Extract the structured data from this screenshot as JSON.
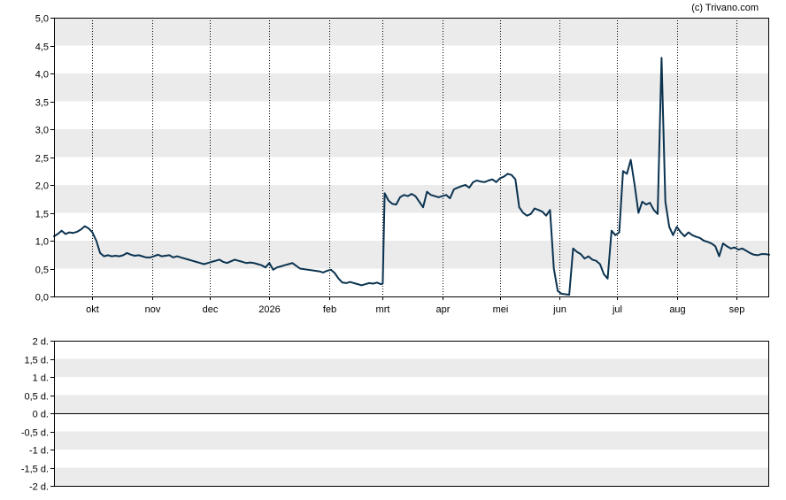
{
  "credit": "(c) Trivano.com",
  "colors": {
    "line": "#0b3350",
    "band": "#ebebeb",
    "border": "#000000",
    "month_grid": "#000000"
  },
  "chart_data": [
    {
      "type": "line",
      "title": "",
      "xlabel": "",
      "ylabel": "",
      "ylim": [
        0,
        5
      ],
      "grid": "alternating horizontal bands; dotted vertical lines at month starts",
      "y_ticks": [
        "0,0",
        "0,5",
        "1,0",
        "1,5",
        "2,0",
        "2,5",
        "3,0",
        "3,5",
        "4,0",
        "4,5",
        "5,0"
      ],
      "x_ticks": [
        {
          "label": "okt",
          "day": 20
        },
        {
          "label": "nov",
          "day": 51
        },
        {
          "label": "dec",
          "day": 81
        },
        {
          "label": "2026",
          "day": 112
        },
        {
          "label": "feb",
          "day": 143
        },
        {
          "label": "mrt",
          "day": 171
        },
        {
          "label": "apr",
          "day": 202
        },
        {
          "label": "mei",
          "day": 232
        },
        {
          "label": "jun",
          "day": 263
        },
        {
          "label": "jul",
          "day": 293
        },
        {
          "label": "aug",
          "day": 324
        },
        {
          "label": "sep",
          "day": 355
        }
      ],
      "x_domain": [
        0,
        372
      ],
      "series": [
        {
          "points": [
            [
              0,
              1.08
            ],
            [
              2,
              1.12
            ],
            [
              4,
              1.18
            ],
            [
              6,
              1.12
            ],
            [
              8,
              1.15
            ],
            [
              10,
              1.14
            ],
            [
              12,
              1.16
            ],
            [
              14,
              1.2
            ],
            [
              16,
              1.26
            ],
            [
              18,
              1.22
            ],
            [
              20,
              1.15
            ],
            [
              22,
              1.0
            ],
            [
              24,
              0.78
            ],
            [
              26,
              0.72
            ],
            [
              28,
              0.74
            ],
            [
              30,
              0.72
            ],
            [
              32,
              0.73
            ],
            [
              34,
              0.72
            ],
            [
              36,
              0.74
            ],
            [
              38,
              0.78
            ],
            [
              40,
              0.75
            ],
            [
              42,
              0.73
            ],
            [
              44,
              0.74
            ],
            [
              46,
              0.72
            ],
            [
              48,
              0.7
            ],
            [
              50,
              0.7
            ],
            [
              52,
              0.72
            ],
            [
              54,
              0.75
            ],
            [
              56,
              0.72
            ],
            [
              58,
              0.73
            ],
            [
              60,
              0.74
            ],
            [
              62,
              0.7
            ],
            [
              64,
              0.72
            ],
            [
              66,
              0.7
            ],
            [
              68,
              0.68
            ],
            [
              70,
              0.66
            ],
            [
              72,
              0.64
            ],
            [
              74,
              0.62
            ],
            [
              76,
              0.6
            ],
            [
              78,
              0.58
            ],
            [
              80,
              0.6
            ],
            [
              82,
              0.62
            ],
            [
              84,
              0.64
            ],
            [
              86,
              0.66
            ],
            [
              88,
              0.62
            ],
            [
              90,
              0.6
            ],
            [
              92,
              0.63
            ],
            [
              94,
              0.66
            ],
            [
              96,
              0.64
            ],
            [
              98,
              0.62
            ],
            [
              100,
              0.6
            ],
            [
              102,
              0.61
            ],
            [
              104,
              0.6
            ],
            [
              106,
              0.58
            ],
            [
              108,
              0.56
            ],
            [
              110,
              0.52
            ],
            [
              112,
              0.6
            ],
            [
              114,
              0.48
            ],
            [
              116,
              0.52
            ],
            [
              118,
              0.54
            ],
            [
              120,
              0.56
            ],
            [
              122,
              0.58
            ],
            [
              124,
              0.6
            ],
            [
              126,
              0.55
            ],
            [
              128,
              0.5
            ],
            [
              130,
              0.49
            ],
            [
              132,
              0.48
            ],
            [
              134,
              0.47
            ],
            [
              136,
              0.46
            ],
            [
              138,
              0.45
            ],
            [
              140,
              0.43
            ],
            [
              142,
              0.46
            ],
            [
              144,
              0.48
            ],
            [
              146,
              0.42
            ],
            [
              148,
              0.32
            ],
            [
              150,
              0.25
            ],
            [
              152,
              0.24
            ],
            [
              154,
              0.26
            ],
            [
              156,
              0.24
            ],
            [
              158,
              0.22
            ],
            [
              160,
              0.2
            ],
            [
              162,
              0.22
            ],
            [
              164,
              0.24
            ],
            [
              166,
              0.23
            ],
            [
              168,
              0.25
            ],
            [
              170,
              0.22
            ],
            [
              171,
              0.23
            ],
            [
              172,
              1.85
            ],
            [
              174,
              1.72
            ],
            [
              176,
              1.66
            ],
            [
              178,
              1.65
            ],
            [
              180,
              1.78
            ],
            [
              182,
              1.82
            ],
            [
              184,
              1.8
            ],
            [
              186,
              1.84
            ],
            [
              188,
              1.8
            ],
            [
              190,
              1.7
            ],
            [
              192,
              1.6
            ],
            [
              194,
              1.88
            ],
            [
              196,
              1.82
            ],
            [
              198,
              1.8
            ],
            [
              200,
              1.78
            ],
            [
              202,
              1.8
            ],
            [
              204,
              1.82
            ],
            [
              206,
              1.76
            ],
            [
              208,
              1.92
            ],
            [
              210,
              1.95
            ],
            [
              212,
              1.98
            ],
            [
              214,
              2.0
            ],
            [
              216,
              1.95
            ],
            [
              218,
              2.05
            ],
            [
              220,
              2.08
            ],
            [
              222,
              2.06
            ],
            [
              224,
              2.05
            ],
            [
              226,
              2.08
            ],
            [
              228,
              2.1
            ],
            [
              230,
              2.05
            ],
            [
              232,
              2.12
            ],
            [
              234,
              2.15
            ],
            [
              236,
              2.2
            ],
            [
              238,
              2.18
            ],
            [
              240,
              2.1
            ],
            [
              242,
              1.6
            ],
            [
              244,
              1.5
            ],
            [
              246,
              1.45
            ],
            [
              248,
              1.48
            ],
            [
              250,
              1.58
            ],
            [
              252,
              1.55
            ],
            [
              254,
              1.52
            ],
            [
              256,
              1.45
            ],
            [
              258,
              1.55
            ],
            [
              260,
              0.5
            ],
            [
              262,
              0.1
            ],
            [
              264,
              0.05
            ],
            [
              266,
              0.04
            ],
            [
              268,
              0.03
            ],
            [
              270,
              0.86
            ],
            [
              272,
              0.8
            ],
            [
              274,
              0.76
            ],
            [
              276,
              0.68
            ],
            [
              278,
              0.72
            ],
            [
              280,
              0.66
            ],
            [
              282,
              0.64
            ],
            [
              284,
              0.58
            ],
            [
              286,
              0.4
            ],
            [
              288,
              0.32
            ],
            [
              290,
              1.18
            ],
            [
              292,
              1.1
            ],
            [
              294,
              1.15
            ],
            [
              296,
              2.25
            ],
            [
              298,
              2.2
            ],
            [
              300,
              2.45
            ],
            [
              302,
              2.0
            ],
            [
              304,
              1.5
            ],
            [
              306,
              1.7
            ],
            [
              308,
              1.65
            ],
            [
              310,
              1.68
            ],
            [
              312,
              1.55
            ],
            [
              314,
              1.48
            ],
            [
              316,
              4.28
            ],
            [
              318,
              1.7
            ],
            [
              320,
              1.25
            ],
            [
              322,
              1.1
            ],
            [
              324,
              1.25
            ],
            [
              326,
              1.15
            ],
            [
              328,
              1.08
            ],
            [
              330,
              1.15
            ],
            [
              332,
              1.1
            ],
            [
              334,
              1.07
            ],
            [
              336,
              1.05
            ],
            [
              338,
              1.0
            ],
            [
              340,
              0.98
            ],
            [
              342,
              0.95
            ],
            [
              344,
              0.9
            ],
            [
              346,
              0.72
            ],
            [
              348,
              0.95
            ],
            [
              350,
              0.9
            ],
            [
              352,
              0.86
            ],
            [
              354,
              0.88
            ],
            [
              356,
              0.84
            ],
            [
              358,
              0.86
            ],
            [
              360,
              0.82
            ],
            [
              362,
              0.78
            ],
            [
              364,
              0.75
            ],
            [
              366,
              0.74
            ],
            [
              368,
              0.76
            ],
            [
              370,
              0.76
            ],
            [
              372,
              0.75
            ]
          ]
        }
      ]
    },
    {
      "type": "line",
      "title": "",
      "xlabel": "",
      "ylabel": "",
      "ylim": [
        -2,
        2
      ],
      "grid": "alternating horizontal bands",
      "y_ticks": [
        "2 d.",
        "1,5 d.",
        "1 d.",
        "0,5 d.",
        "0 d.",
        "-0,5 d.",
        "-1 d.",
        "-1,5 d.",
        "-2 d."
      ],
      "zero_line": 0,
      "series": []
    }
  ]
}
